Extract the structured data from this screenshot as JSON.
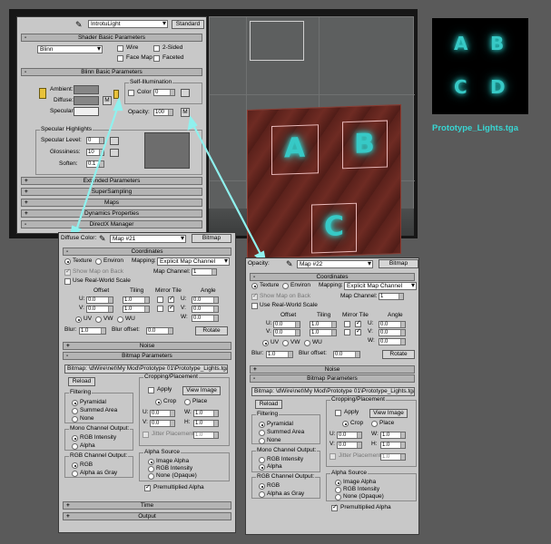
{
  "thumbnail": {
    "letters": [
      "A",
      "B",
      "C",
      "D"
    ],
    "caption": "Prototype_Lights.tga"
  },
  "scene": {
    "plane_letters": [
      "A",
      "B",
      "C"
    ]
  },
  "colors": {
    "accent_cyan": "#38d6d3",
    "arrow": "#8ff1ee",
    "plane_red": "#6a2a22"
  },
  "material_editor": {
    "material_name": "IntrotuLight",
    "material_type": "Standard",
    "shader_basic": {
      "title": "Shader Basic Parameters",
      "shader": "Blinn",
      "wire": "Wire",
      "two_sided": "2-Sided",
      "face_map": "Face Map",
      "faceted": "Faceted"
    },
    "blinn_basic": {
      "title": "Blinn Basic Parameters",
      "self_illum": "Self-Illumination",
      "color_label": "Color",
      "color_value": "0",
      "ambient": "Ambient:",
      "diffuse": "Diffuse:",
      "specular": "Specular:",
      "m": "M",
      "opacity_label": "Opacity:",
      "opacity_value": "100",
      "spec_highlights": "Specular Highlights",
      "spec_level": "Specular Level:",
      "spec_level_value": "0",
      "glossiness": "Glossiness:",
      "glossiness_value": "10",
      "soften": "Soften:",
      "soften_value": "0.1"
    },
    "rollouts": [
      "Extended Parameters",
      "SuperSampling",
      "Maps",
      "Dynamics Properties",
      "DirectX Manager"
    ]
  },
  "map_left": {
    "slot_label": "Diffuse Color:",
    "map_name": "Map #21",
    "map_type": "Bitmap"
  },
  "map_right": {
    "slot_label": "Opacity:",
    "map_name": "Map #22",
    "map_type": "Bitmap"
  },
  "coords": {
    "title": "Coordinates",
    "texture": "Texture",
    "environ": "Environ",
    "mapping_label": "Mapping:",
    "mapping_value": "Explicit Map Channel",
    "show_map_back": "Show Map on Back",
    "map_channel": "Map Channel:",
    "map_channel_value": "1",
    "use_real_world": "Use Real-World Scale",
    "offset": "Offset",
    "tiling": "Tiling",
    "mirror_tile": "Mirror Tile",
    "angle": "Angle",
    "u": "U:",
    "v": "V:",
    "w": "W:",
    "u_offset": "0.0",
    "v_offset": "0.0",
    "u_tiling": "1.0",
    "v_tiling": "1.0",
    "u_angle": "0.0",
    "v_angle": "0.0",
    "w_angle": "0.0",
    "uv": "UV",
    "vw": "VW",
    "wu": "WU",
    "blur": "Blur:",
    "blur_value": "1.0",
    "blur_offset": "Blur offset:",
    "blur_offset_value": "0.0",
    "rotate": "Rotate"
  },
  "noise_title": "Noise",
  "bitmap_params": {
    "title": "Bitmap Parameters",
    "bitmap_label": "Bitmap:",
    "path_left": "\\dWire\\net\\My Mod\\Prototype 01\\Prototype_Lights.tga",
    "path_right": "\\dWire\\net\\My Mod\\Prototype 01\\Prototype_Lights.tga",
    "reload": "Reload",
    "cropping": "Cropping/Placement",
    "apply": "Apply",
    "view_image": "View Image",
    "crop": "Crop",
    "place": "Place",
    "u": "U:",
    "v": "V:",
    "w": "W:",
    "h": "H:",
    "u_val": "0.0",
    "v_val": "0.0",
    "w_val": "1.0",
    "h_val": "1.0",
    "jitter": "Jitter Placement:",
    "jitter_val": "1.0",
    "filtering": "Filtering",
    "pyramidal": "Pyramidal",
    "summed_area": "Summed Area",
    "none": "None",
    "mono_output": "Mono Channel Output:",
    "rgb_intensity": "RGB Intensity",
    "alpha": "Alpha",
    "rgb_output": "RGB Channel Output:",
    "rgb": "RGB",
    "alpha_as_gray": "Alpha as Gray",
    "alpha_source": "Alpha Source",
    "image_alpha": "Image Alpha",
    "none_opaque": "None (Opaque)",
    "premultiplied": "Premultiplied Alpha"
  },
  "time_title": "Time",
  "output_title": "Output"
}
